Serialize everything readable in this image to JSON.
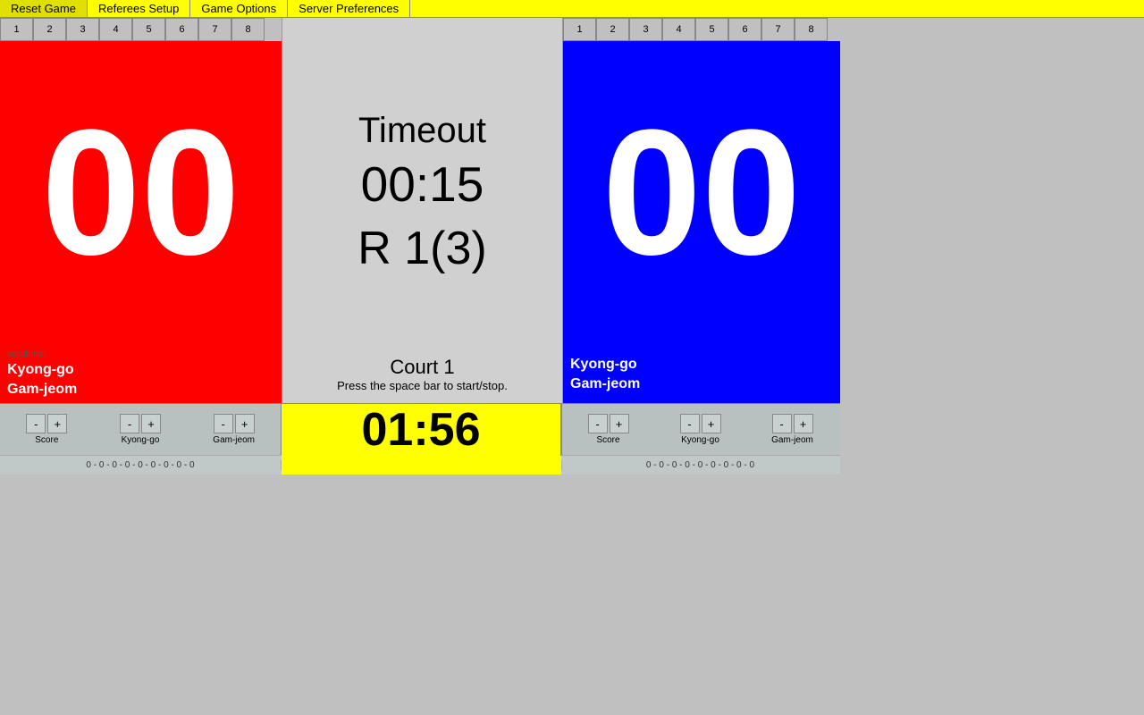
{
  "menu": {
    "items": [
      {
        "label": "Reset Game",
        "name": "reset-game"
      },
      {
        "label": "Referees Setup",
        "name": "referees-setup"
      },
      {
        "label": "Game Options",
        "name": "game-options"
      },
      {
        "label": "Server Preferences",
        "name": "server-preferences"
      }
    ]
  },
  "rounds": {
    "left": [
      "1",
      "2",
      "3",
      "4",
      "5",
      "6",
      "7",
      "8"
    ],
    "right": [
      "1",
      "2",
      "3",
      "4",
      "5",
      "6",
      "7",
      "8"
    ],
    "active": 1
  },
  "center": {
    "timeout_label": "Timeout",
    "timeout_time": "00:15",
    "round_label": "R 1(3)"
  },
  "left": {
    "score": "00",
    "kyong_go": "Kyong-go",
    "gam_jeom": "Gam-jeom",
    "sandtimer": "sandtimer"
  },
  "right": {
    "score": "00",
    "kyong_go": "Kyong-go",
    "gam_jeom": "Gam-jeom"
  },
  "court": {
    "name": "Court 1",
    "hint": "Press the space bar to start/stop."
  },
  "main_timer": "01:56",
  "controls": {
    "score_label": "Score",
    "kyong_go_label": "Kyong-go",
    "gam_jeom_label": "Gam-jeom",
    "minus": "-",
    "plus": "+"
  },
  "counters": {
    "left": [
      "0",
      "-",
      "0",
      "-",
      "0",
      "-",
      "0",
      "-",
      "0",
      "-",
      "0",
      "-",
      "0",
      "-",
      "0",
      "-",
      "0"
    ],
    "right": [
      "0",
      "-",
      "0",
      "-",
      "0",
      "-",
      "0",
      "-",
      "0",
      "-",
      "0",
      "-",
      "0",
      "-",
      "0",
      "-",
      "0"
    ]
  }
}
